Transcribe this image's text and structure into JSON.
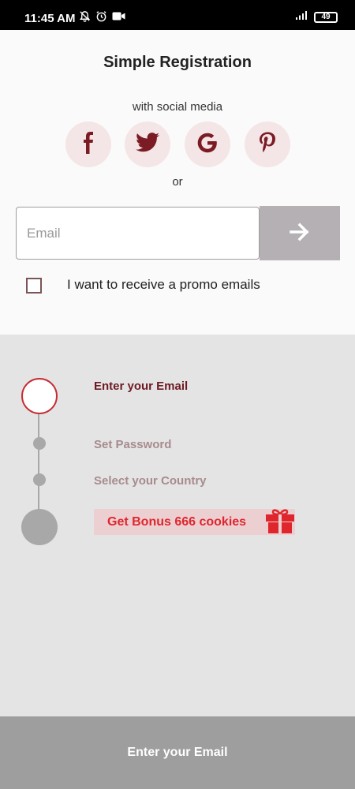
{
  "status_bar": {
    "time": "11:45 AM",
    "battery": "49",
    "icons": [
      "notification-off-icon",
      "alarm-icon",
      "video-icon",
      "signal-icon",
      "battery-icon"
    ]
  },
  "registration": {
    "title": "Simple Registration",
    "social_caption": "with social media",
    "social_buttons": [
      "facebook",
      "twitter",
      "google",
      "pinterest"
    ],
    "or_text": "or",
    "email_placeholder": "Email",
    "promo_label": "I want to receive a promo emails",
    "promo_checked": false
  },
  "steps": {
    "items": [
      {
        "label": "Enter your Email",
        "state": "active"
      },
      {
        "label": "Set Password",
        "state": "pending"
      },
      {
        "label": "Select your Country",
        "state": "pending"
      }
    ],
    "bonus": "Get Bonus 666 cookies"
  },
  "bottom_button": {
    "label": "Enter your Email"
  },
  "colors": {
    "accent": "#c62c33",
    "bonus_text": "#e0262d",
    "panel": "#e4e4e5",
    "bottom_bar": "#9e9e9e"
  }
}
